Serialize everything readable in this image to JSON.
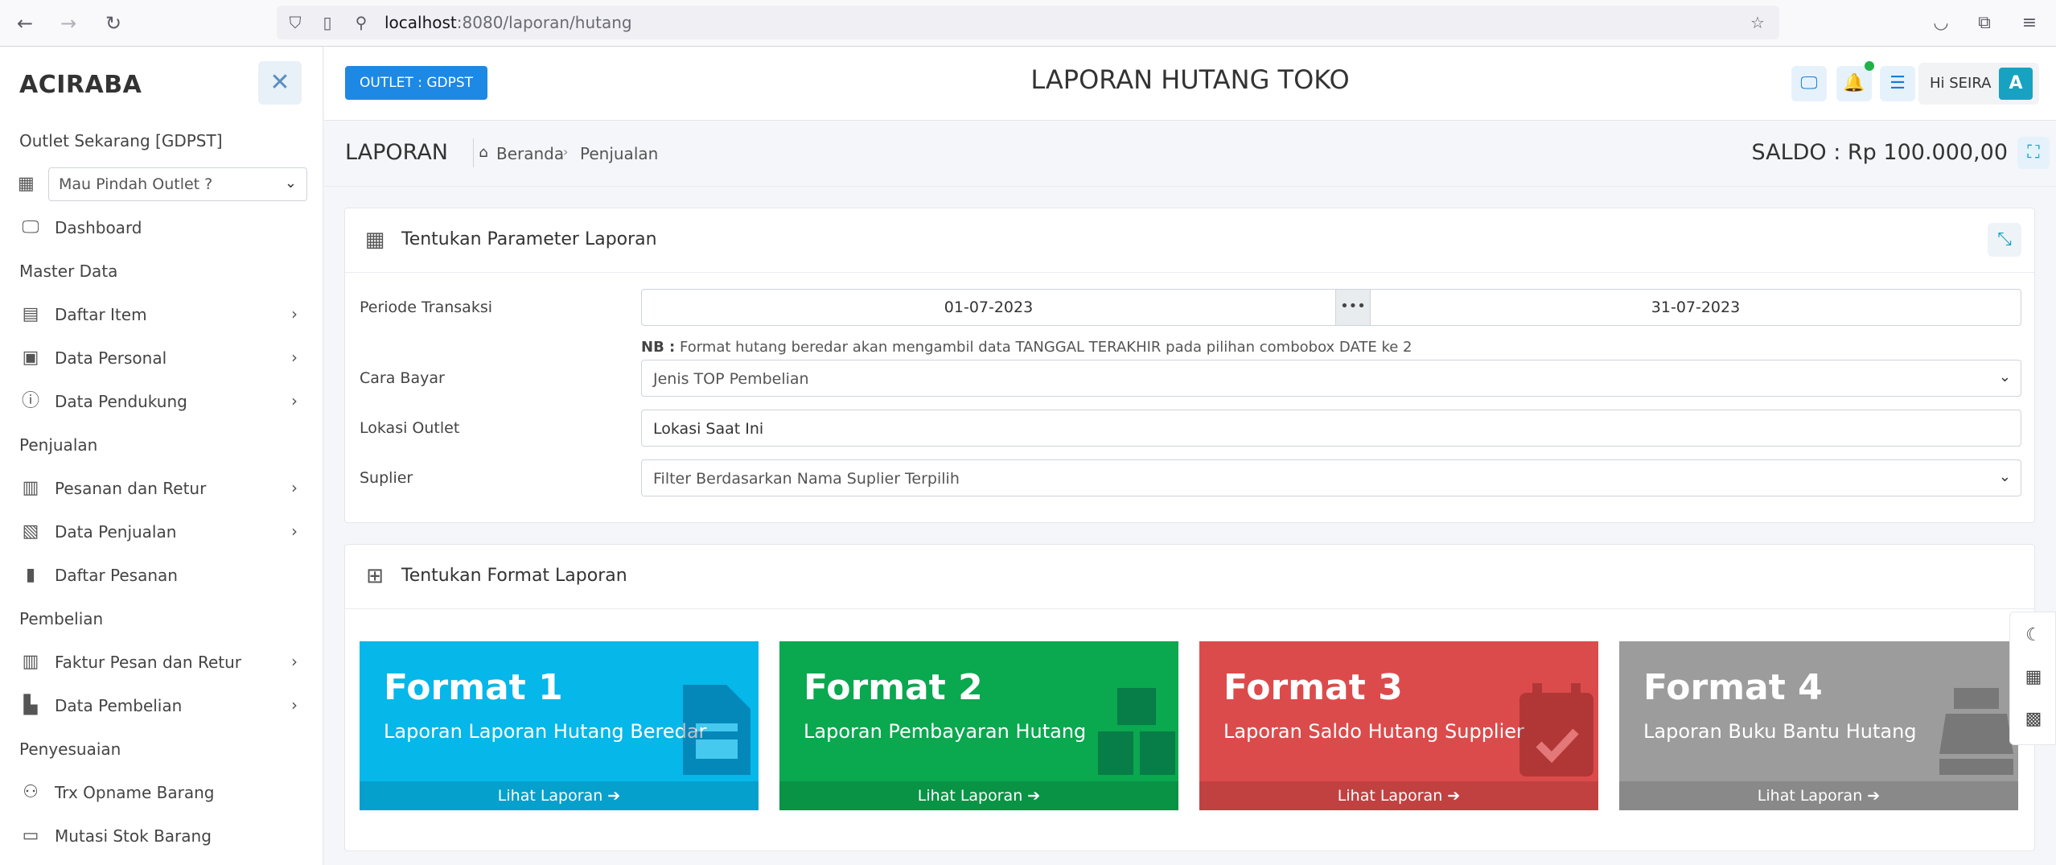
{
  "browser": {
    "url_host": "localhost",
    "url_rest": ":8080/laporan/hutang"
  },
  "sidebar": {
    "brand": "ACIRABA",
    "outlet_label": "Outlet Sekarang [GDPST]",
    "outlet_select_placeholder": "Mau Pindah Outlet ?",
    "items": [
      {
        "label": "Dashboard"
      },
      {
        "label": "Daftar Item"
      },
      {
        "label": "Data Personal"
      },
      {
        "label": "Data Pendukung"
      },
      {
        "label": "Pesanan dan Retur"
      },
      {
        "label": "Data Penjualan"
      },
      {
        "label": "Daftar Pesanan"
      },
      {
        "label": "Faktur Pesan dan Retur"
      },
      {
        "label": "Data Pembelian"
      },
      {
        "label": "Trx Opname Barang"
      },
      {
        "label": "Mutasi Stok Barang"
      }
    ],
    "sections": [
      "Master Data",
      "Penjualan",
      "Pembelian",
      "Penyesuaian"
    ]
  },
  "topbar": {
    "outlet_button": "OUTLET : GDPST",
    "title": "LAPORAN HUTANG TOKO",
    "greeting": "Hi SEIRA",
    "avatar_letter": "A"
  },
  "breadcrumb": {
    "title": "LAPORAN",
    "home": "Beranda",
    "current": "Penjualan",
    "saldo": "SALDO : Rp 100.000,00"
  },
  "params_card": {
    "title": "Tentukan Parameter Laporan",
    "periode_label": "Periode Transaksi",
    "date_start": "01-07-2023",
    "date_sep": "•••",
    "date_end": "31-07-2023",
    "nb_prefix": "NB :",
    "nb_text": "Format hutang beredar akan mengambil data TANGGAL TERAKHIR pada pilihan combobox DATE ke 2",
    "cara_bayar_label": "Cara Bayar",
    "cara_bayar_value": "Jenis TOP Pembelian",
    "lokasi_label": "Lokasi Outlet",
    "lokasi_value": "Lokasi Saat Ini",
    "suplier_label": "Suplier",
    "suplier_value": "Filter Berdasarkan Nama Suplier Terpilih"
  },
  "format_card": {
    "title": "Tentukan Format Laporan",
    "tiles": [
      {
        "title": "Format 1",
        "subtitle": "Laporan Laporan Hutang Beredar",
        "footer": "Lihat Laporan ➔",
        "color": "#06b7e9"
      },
      {
        "title": "Format 2",
        "subtitle": "Laporan Pembayaran Hutang",
        "footer": "Lihat Laporan ➔",
        "color": "#0aa84f"
      },
      {
        "title": "Format 3",
        "subtitle": "Laporan Saldo Hutang Supplier",
        "footer": "Lihat Laporan ➔",
        "color": "#dc4b4b"
      },
      {
        "title": "Format 4",
        "subtitle": "Laporan Buku Bantu Hutang",
        "footer": "Lihat Laporan ➔",
        "color": "#9c9c9c"
      }
    ]
  }
}
